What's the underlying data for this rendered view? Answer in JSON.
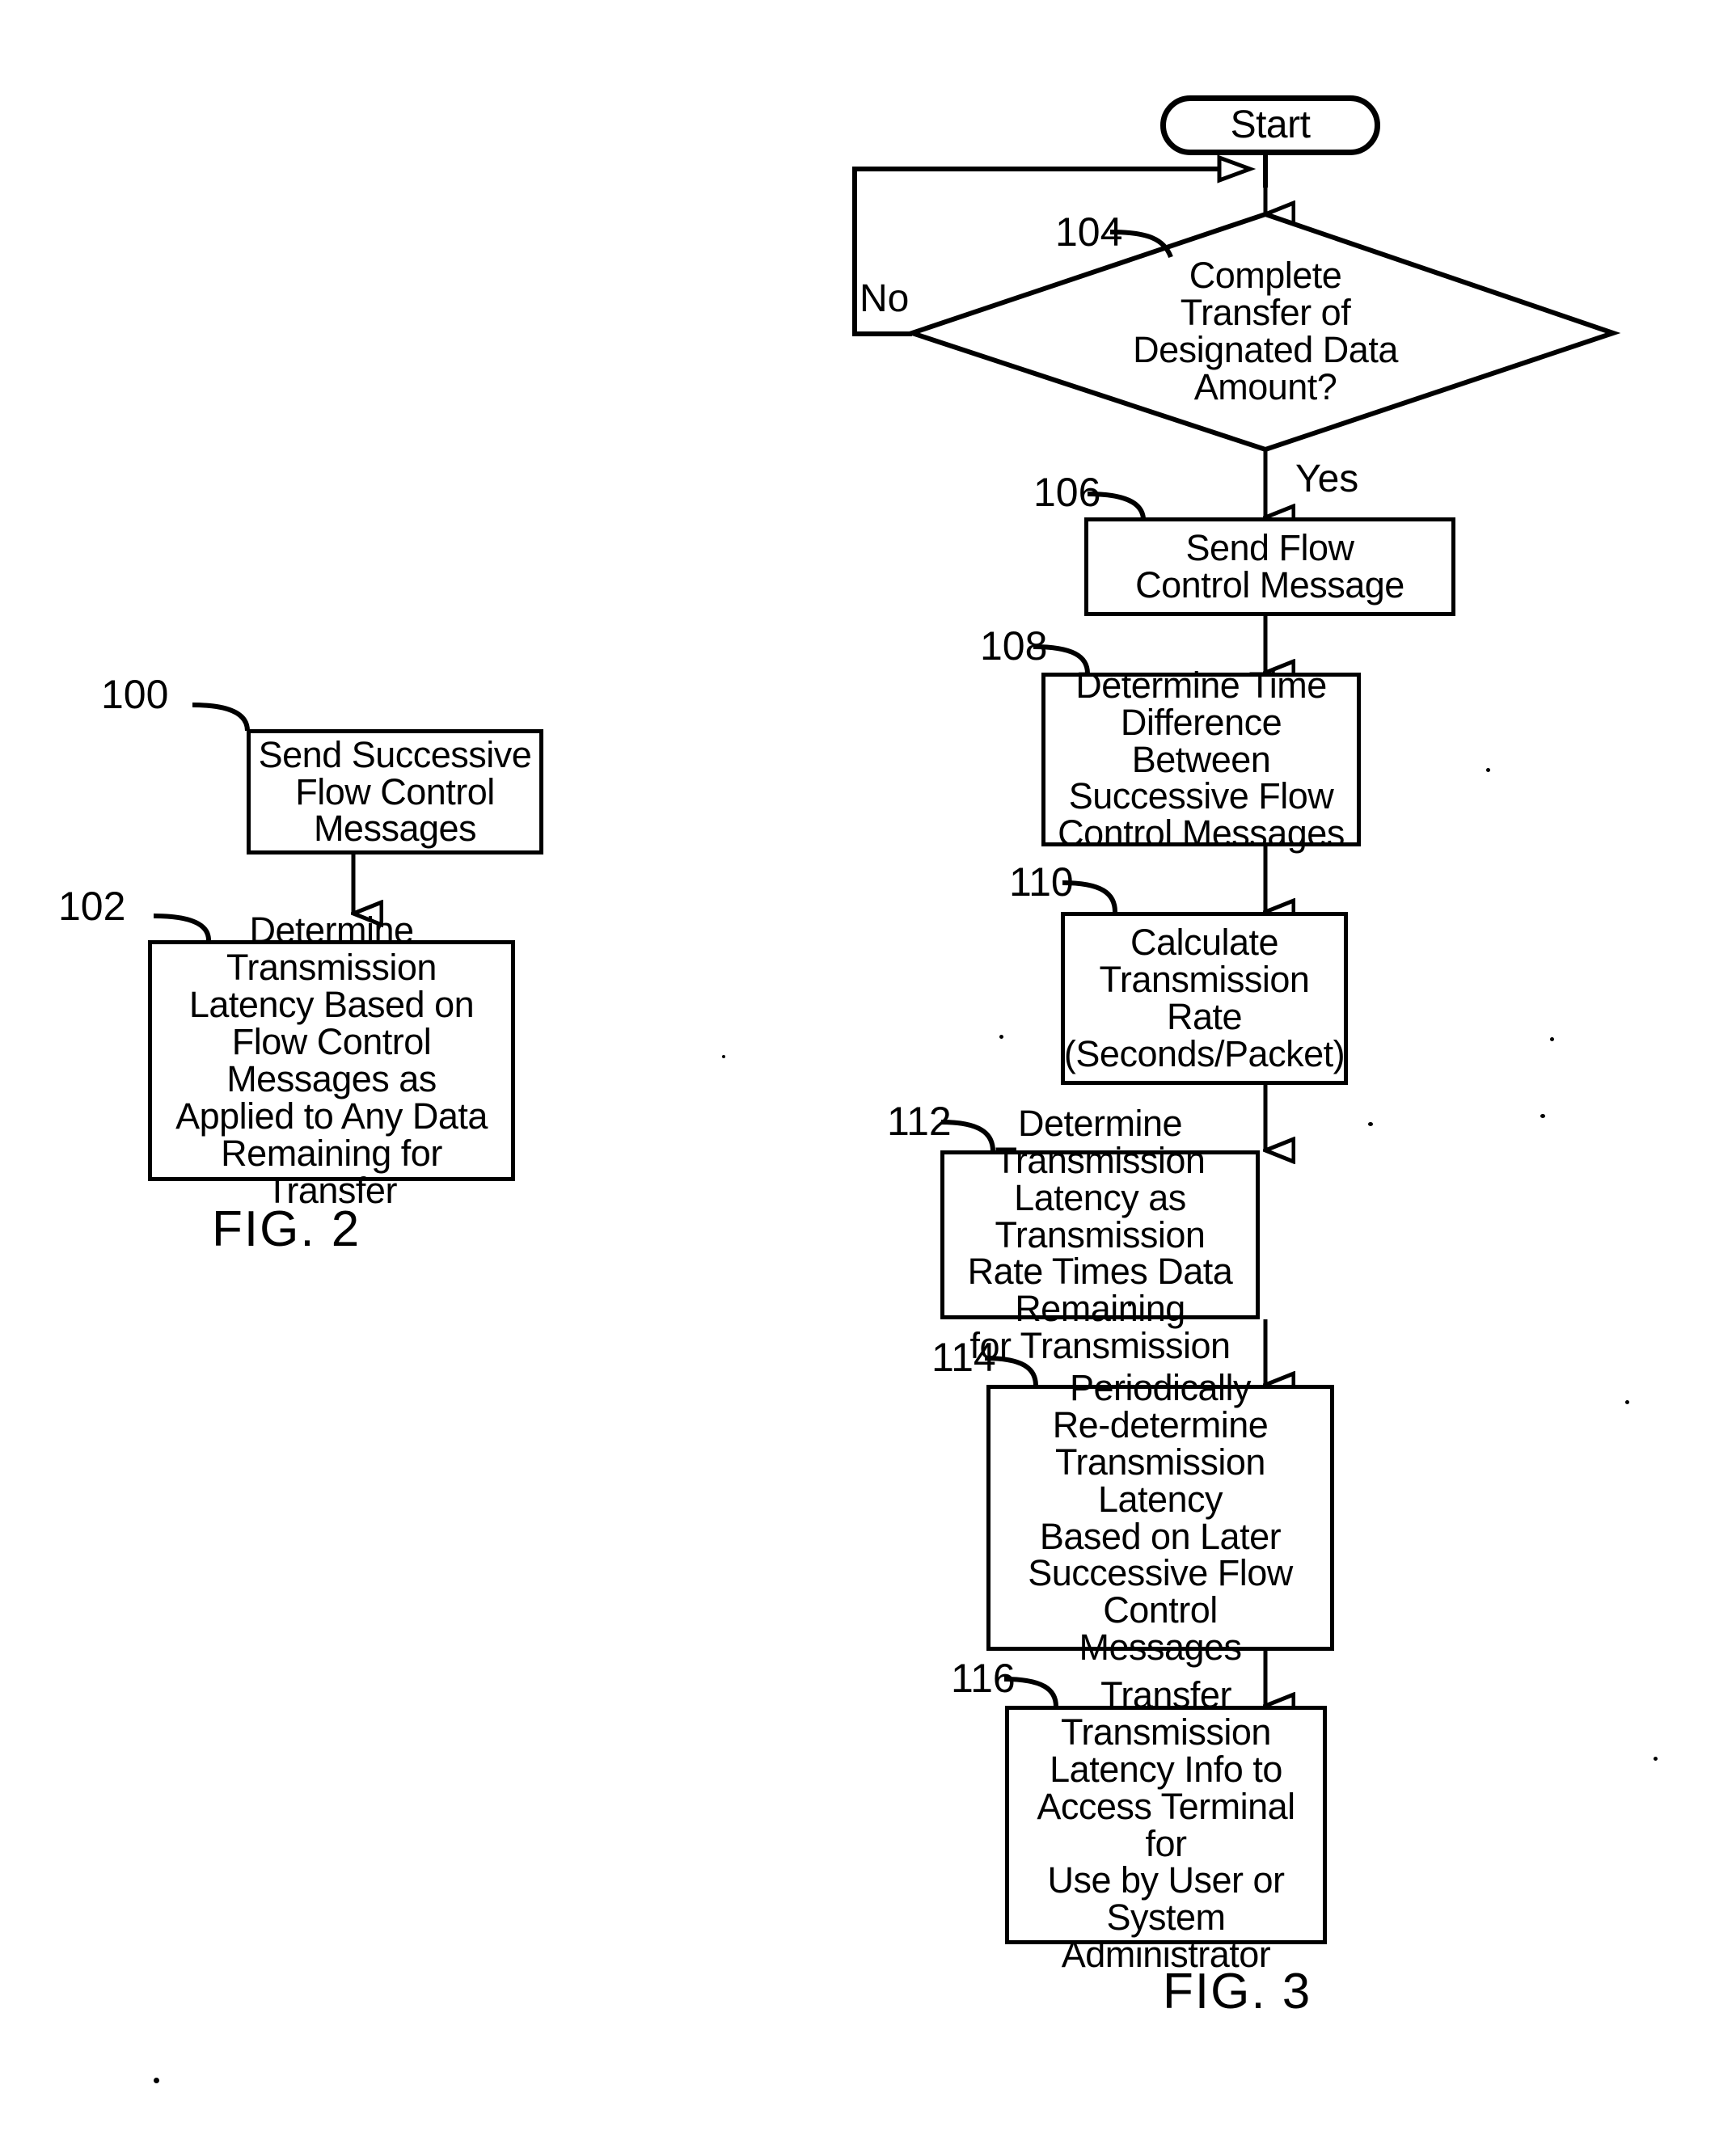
{
  "document": {
    "type": "patent-flowchart-drawing",
    "figures": [
      {
        "id": "fig2",
        "label": "FIG.  2",
        "nodes": [
          {
            "ref": "100",
            "shape": "process",
            "text": "Send Successive\nFlow Control\nMessages"
          },
          {
            "ref": "102",
            "shape": "process",
            "text": "Determine Transmission\nLatency Based on\nFlow Control Messages as\nApplied to Any Data\nRemaining for Transfer"
          }
        ]
      },
      {
        "id": "fig3",
        "label": "FIG.  3",
        "nodes": [
          {
            "ref": "",
            "shape": "terminator",
            "text": "Start"
          },
          {
            "ref": "104",
            "shape": "decision",
            "text": "Complete\nTransfer of\nDesignated Data\nAmount?"
          },
          {
            "ref": "106",
            "shape": "process",
            "text": "Send Flow\nControl Message"
          },
          {
            "ref": "108",
            "shape": "process",
            "text": "Determine Time\nDifference Between\nSuccessive Flow\nControl Messages"
          },
          {
            "ref": "110",
            "shape": "process",
            "text": "Calculate\nTransmission\nRate\n(Seconds/Packet)"
          },
          {
            "ref": "112",
            "shape": "process",
            "text": "Determine Transmission\nLatency as Transmission\nRate Times Data Remaining\nfor Transmission"
          },
          {
            "ref": "114",
            "shape": "process",
            "text": "Periodically\nRe-determine\nTransmission Latency\nBased on Later\nSuccessive Flow Control\nMessages"
          },
          {
            "ref": "116",
            "shape": "process",
            "text": "Transfer Transmission\nLatency Info to\nAccess Terminal for\nUse by User or\nSystem Administrator"
          }
        ],
        "edge_labels": {
          "no": "No",
          "yes": "Yes"
        }
      }
    ],
    "colors": {
      "ink": "#000000",
      "paper": "#ffffff"
    }
  }
}
